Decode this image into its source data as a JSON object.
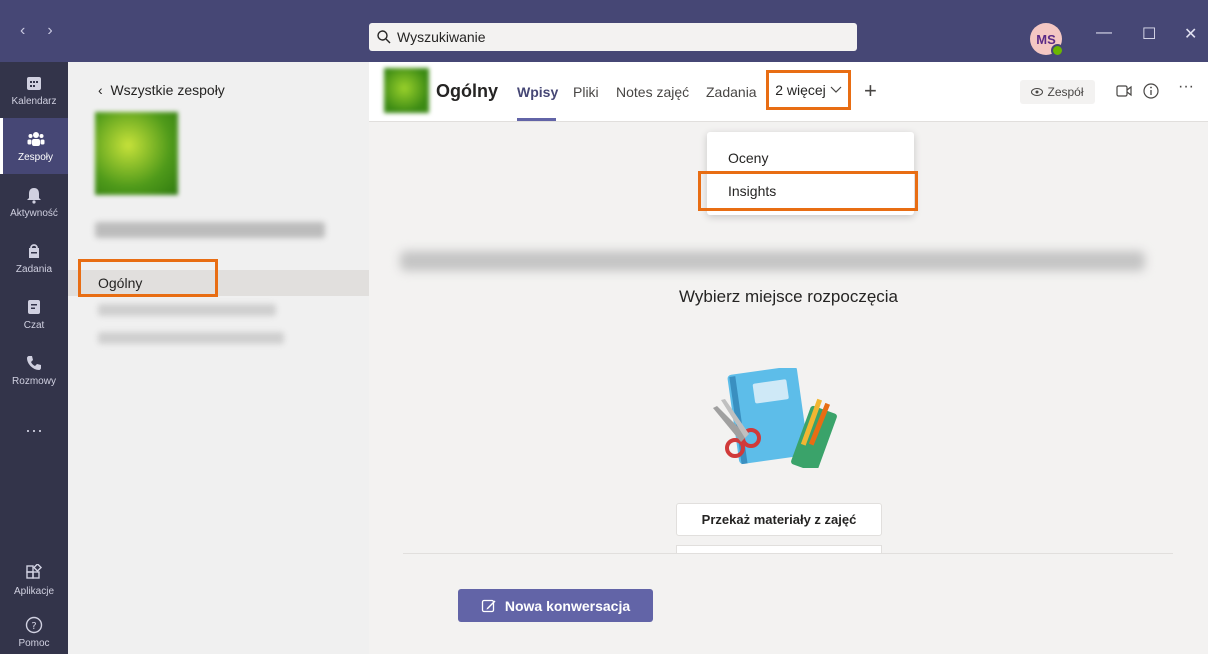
{
  "titlebar": {
    "search_placeholder": "Wyszukiwanie",
    "avatar_initials": "MS",
    "nav_back": "‹",
    "nav_forward": "›",
    "minimize": "—",
    "maximize": "☐",
    "close": "✕"
  },
  "rail": {
    "items": [
      {
        "label": "Kalendarz",
        "icon": "calendar-icon"
      },
      {
        "label": "Zespoły",
        "icon": "teams-icon",
        "active": true
      },
      {
        "label": "Aktywność",
        "icon": "bell-icon"
      },
      {
        "label": "Zadania",
        "icon": "assignments-icon"
      },
      {
        "label": "Czat",
        "icon": "chat-icon"
      },
      {
        "label": "Rozmowy",
        "icon": "phone-icon"
      },
      {
        "label": "···",
        "icon": "more-icon"
      }
    ],
    "bottom": [
      {
        "label": "Aplikacje",
        "icon": "apps-icon"
      },
      {
        "label": "Pomoc",
        "icon": "help-icon"
      }
    ]
  },
  "teams_pane": {
    "back_label": "Wszystkie zespoły",
    "channel": "Ogólny"
  },
  "header": {
    "channel_title": "Ogólny",
    "tabs": [
      {
        "label": "Wpisy",
        "active": true
      },
      {
        "label": "Pliki"
      },
      {
        "label": "Notes zajęć"
      },
      {
        "label": "Zadania"
      }
    ],
    "more_tab": "2 więcej",
    "plus": "+",
    "team_button": "Zespół",
    "more": "···"
  },
  "dropdown": {
    "items": [
      "Oceny",
      "Insights"
    ]
  },
  "content": {
    "subtitle": "Wybierz miejsce rozpoczęcia",
    "materials_button": "Przekaż materiały z zajęć",
    "new_conversation": "Nowa konwersacja"
  },
  "colors": {
    "titlebar": "#464775",
    "rail": "#33344a",
    "accent": "#6264a7",
    "highlight": "#e86d13"
  }
}
